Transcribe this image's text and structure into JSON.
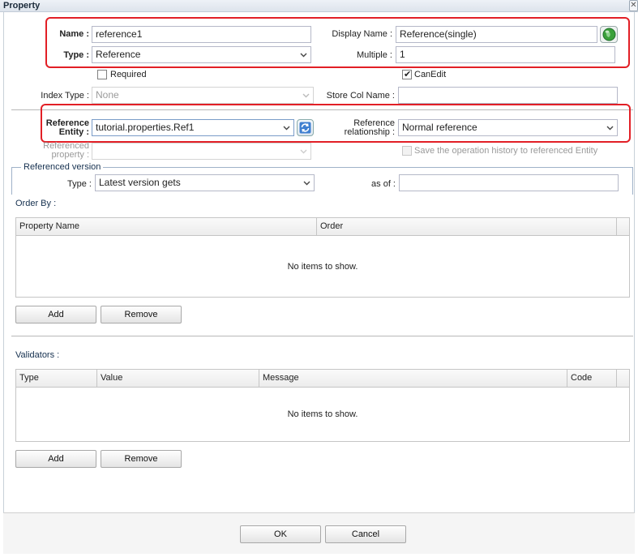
{
  "window": {
    "title": "Property",
    "close_glyph": "✕"
  },
  "form": {
    "name": {
      "label": "Name :",
      "value": "reference1"
    },
    "type": {
      "label": "Type :",
      "value": "Reference"
    },
    "display_name": {
      "label": "Display Name :",
      "value": "Reference(single)"
    },
    "multiple": {
      "label": "Multiple :",
      "value": "1"
    },
    "required": {
      "label": "Required",
      "checked": false
    },
    "can_edit": {
      "label": "CanEdit",
      "checked": true
    },
    "index_type": {
      "label": "Index Type :",
      "value": "None"
    },
    "store_col_name": {
      "label": "Store Col Name :",
      "value": ""
    },
    "reference_entity": {
      "label_line1": "Reference",
      "label_line2": "Entity :",
      "value": "tutorial.properties.Ref1"
    },
    "reference_relationship": {
      "label_line1": "Reference",
      "label_line2": "relationship :",
      "value": "Normal reference"
    },
    "referenced_property": {
      "label_line1": "Referenced",
      "label_line2": "property :",
      "value": ""
    },
    "save_history": {
      "label": "Save the operation history to referenced Entity",
      "checked": false
    }
  },
  "referenced_version": {
    "legend": "Referenced version",
    "type_label": "Type :",
    "type_value": "Latest version gets",
    "as_of_label": "as of :",
    "as_of_value": ""
  },
  "order_by": {
    "label": "Order By :",
    "columns": [
      "Property Name",
      "Order"
    ],
    "empty_text": "No items to show.",
    "add_label": "Add",
    "remove_label": "Remove"
  },
  "validators": {
    "label": "Validators :",
    "columns": [
      "Type",
      "Value",
      "Message",
      "Code"
    ],
    "empty_text": "No items to show.",
    "add_label": "Add",
    "remove_label": "Remove"
  },
  "footer": {
    "ok_label": "OK",
    "cancel_label": "Cancel"
  },
  "colors": {
    "highlight_border": "#e21f26",
    "accent": "#15304f"
  },
  "icons": {
    "display_name_button": "globe-icon",
    "reference_entity_button": "refresh-icon",
    "dropdown": "chevron-down-icon"
  }
}
